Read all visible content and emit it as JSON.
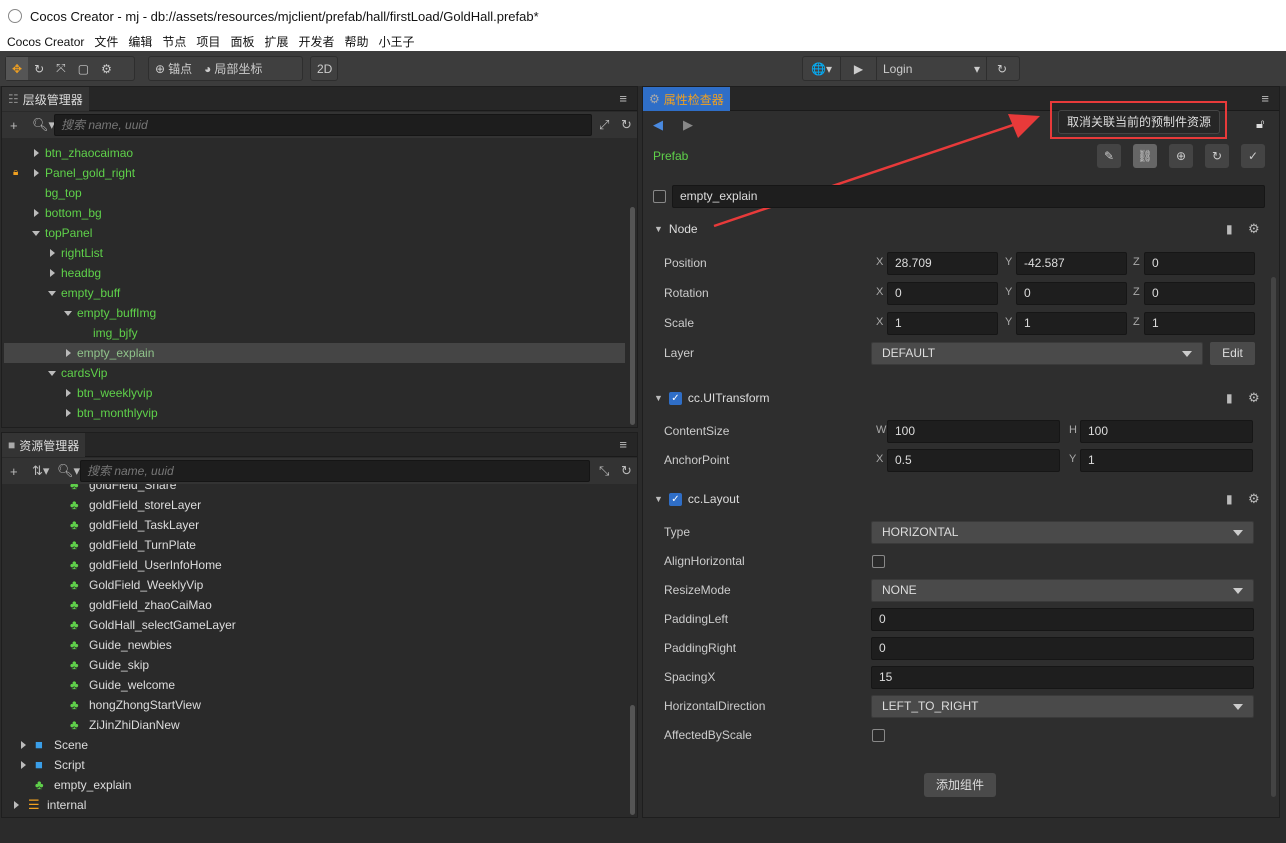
{
  "window": {
    "title": "Cocos Creator - mj - db://assets/resources/mjclient/prefab/hall/firstLoad/GoldHall.prefab*"
  },
  "menu": [
    "Cocos Creator",
    "文件",
    "编辑",
    "节点",
    "项目",
    "面板",
    "扩展",
    "开发者",
    "帮助",
    "小王子"
  ],
  "toolbar": {
    "anchor": "锚点",
    "local": "局部坐标",
    "mode2d": "2D",
    "scene": "Login"
  },
  "hierarchy": {
    "title": "层级管理器",
    "search_placeholder": "搜索 name, uuid",
    "items": [
      {
        "label": "btn_zhaocaimao",
        "level": 1,
        "arrow": "right"
      },
      {
        "label": "Panel_gold_right",
        "level": 1,
        "arrow": "right",
        "locked": true
      },
      {
        "label": "bg_top",
        "level": 1,
        "arrow": "none"
      },
      {
        "label": "bottom_bg",
        "level": 1,
        "arrow": "right"
      },
      {
        "label": "topPanel",
        "level": 1,
        "arrow": "down"
      },
      {
        "label": "rightList",
        "level": 2,
        "arrow": "right"
      },
      {
        "label": "headbg",
        "level": 2,
        "arrow": "right"
      },
      {
        "label": "empty_buff",
        "level": 2,
        "arrow": "down"
      },
      {
        "label": "empty_buffImg",
        "level": 3,
        "arrow": "down"
      },
      {
        "label": "img_bjfy",
        "level": 4,
        "arrow": "none"
      },
      {
        "label": "empty_explain",
        "level": 3,
        "arrow": "right",
        "selected": true
      },
      {
        "label": "cardsVip",
        "level": 2,
        "arrow": "down"
      },
      {
        "label": "btn_weeklyvip",
        "level": 3,
        "arrow": "right"
      },
      {
        "label": "btn_monthlyvip",
        "level": 3,
        "arrow": "right"
      }
    ]
  },
  "assets": {
    "title": "资源管理器",
    "search_placeholder": "搜索 name, uuid",
    "items": [
      {
        "label": "goldField_Share",
        "type": "prefab",
        "level": 3
      },
      {
        "label": "goldField_storeLayer",
        "type": "prefab",
        "level": 3
      },
      {
        "label": "goldField_TaskLayer",
        "type": "prefab",
        "level": 3
      },
      {
        "label": "goldField_TurnPlate",
        "type": "prefab",
        "level": 3
      },
      {
        "label": "goldField_UserInfoHome",
        "type": "prefab",
        "level": 3
      },
      {
        "label": "GoldField_WeeklyVip",
        "type": "prefab",
        "level": 3
      },
      {
        "label": "goldField_zhaoCaiMao",
        "type": "prefab",
        "level": 3
      },
      {
        "label": "GoldHall_selectGameLayer",
        "type": "prefab",
        "level": 3
      },
      {
        "label": "Guide_newbies",
        "type": "prefab",
        "level": 3
      },
      {
        "label": "Guide_skip",
        "type": "prefab",
        "level": 3
      },
      {
        "label": "Guide_welcome",
        "type": "prefab",
        "level": 3
      },
      {
        "label": "hongZhongStartView",
        "type": "prefab",
        "level": 3
      },
      {
        "label": "ZiJinZhiDianNew",
        "type": "prefab",
        "level": 3
      },
      {
        "label": "Scene",
        "type": "folder",
        "level": 1,
        "arrow": "right"
      },
      {
        "label": "Script",
        "type": "folder",
        "level": 1,
        "arrow": "right"
      },
      {
        "label": "empty_explain",
        "type": "prefab",
        "level": 1
      },
      {
        "label": "internal",
        "type": "db",
        "level": 0,
        "arrow": "right"
      }
    ]
  },
  "inspector": {
    "title": "属性检查器",
    "tooltip": "取消关联当前的预制件资源",
    "prefab_label": "Prefab",
    "node_name": "empty_explain",
    "node": {
      "title": "Node",
      "position": {
        "label": "Position",
        "x": "28.709",
        "y": "-42.587",
        "z": "0"
      },
      "rotation": {
        "label": "Rotation",
        "x": "0",
        "y": "0",
        "z": "0"
      },
      "scale": {
        "label": "Scale",
        "x": "1",
        "y": "1",
        "z": "1"
      },
      "layer": {
        "label": "Layer",
        "value": "DEFAULT",
        "edit": "Edit"
      }
    },
    "uitransform": {
      "title": "cc.UITransform",
      "content_size": {
        "label": "ContentSize",
        "w": "100",
        "h": "100"
      },
      "anchor": {
        "label": "AnchorPoint",
        "x": "0.5",
        "y": "1"
      }
    },
    "layout": {
      "title": "cc.Layout",
      "type": {
        "label": "Type",
        "value": "HORIZONTAL"
      },
      "align_h": {
        "label": "AlignHorizontal"
      },
      "resize": {
        "label": "ResizeMode",
        "value": "NONE"
      },
      "padding_left": {
        "label": "PaddingLeft",
        "value": "0"
      },
      "padding_right": {
        "label": "PaddingRight",
        "value": "0"
      },
      "spacing_x": {
        "label": "SpacingX",
        "value": "15"
      },
      "direction": {
        "label": "HorizontalDirection",
        "value": "LEFT_TO_RIGHT"
      },
      "affected": {
        "label": "AffectedByScale"
      }
    },
    "add_component": "添加组件",
    "axes": {
      "x": "X",
      "y": "Y",
      "z": "Z",
      "w": "W",
      "h": "H"
    }
  },
  "colors": {
    "accent": "#2f6ec7",
    "node_green": "#5fd14a",
    "annotation_red": "#e83a3a"
  }
}
